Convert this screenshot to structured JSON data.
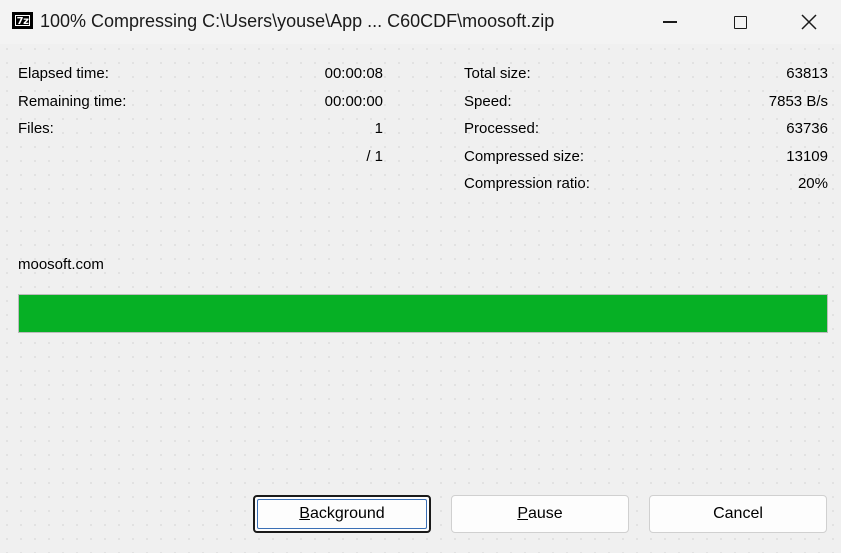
{
  "window": {
    "title": "100% Compressing C:\\Users\\youse\\App ... C60CDF\\moosoft.zip",
    "icon_text": "7z",
    "controls": {
      "minimize": "minimize-icon",
      "maximize": "maximize-icon",
      "close": "close-icon"
    }
  },
  "stats_left": [
    {
      "label": "Elapsed time:",
      "value": "00:00:08"
    },
    {
      "label": "Remaining time:",
      "value": "00:00:00"
    },
    {
      "label": "Files:",
      "value": "1"
    },
    {
      "label": "",
      "value": "/ 1"
    }
  ],
  "stats_right": [
    {
      "label": "Total size:",
      "value": "63813"
    },
    {
      "label": "Speed:",
      "value": "7853 B/s"
    },
    {
      "label": "Processed:",
      "value": "63736"
    },
    {
      "label": "Compressed size:",
      "value": "13109"
    },
    {
      "label": "Compression ratio:",
      "value": "20%"
    }
  ],
  "current_item": "moosoft.com",
  "progress": {
    "percent": 100,
    "color": "#06b025"
  },
  "buttons": {
    "background": {
      "prefix": "",
      "accel": "B",
      "rest": "ackground"
    },
    "pause": {
      "prefix": "",
      "accel": "P",
      "rest": "ause"
    },
    "cancel": {
      "label": "Cancel"
    }
  }
}
